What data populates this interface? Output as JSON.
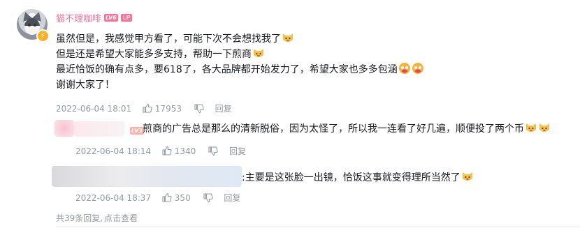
{
  "root_comment": {
    "username": "猫不理咖啡",
    "level": "LV6",
    "up_badge": "UP",
    "verified_icon": "lightning-icon",
    "lines": [
      "虽然但是，我感觉甲方看了，可能下次不会想找我了",
      "但是还是希望大家能多多支持，帮助一下煎商",
      "最近恰饭的确有点多，要618了，各大品牌都开始发力了，希望大家也多多包涵",
      "谢谢大家了！"
    ],
    "date": "2022-06-04 18:01",
    "likes": "17953",
    "reply_label": "回复"
  },
  "replies": [
    {
      "level": "LV3",
      "text": "煎商的广告总是那么的清新脱俗，因为太怪了，所以我一连看了好几遍，顺便投了两个币",
      "date": "2022-06-04 18:14",
      "likes": "1340",
      "reply_label": "回复"
    },
    {
      "text": ":主要是这张脸一出镜，恰饭这事就变得理所当然了",
      "date": "2022-06-04 18:37",
      "likes": "350",
      "reply_label": "回复"
    }
  ],
  "footer": {
    "total_replies": "共39条回复,",
    "view_link": "点击查看"
  },
  "colors": {
    "accent": "#fb7299",
    "meta": "#9499a0",
    "verify": "#ffb027",
    "link": "#00aeec"
  }
}
